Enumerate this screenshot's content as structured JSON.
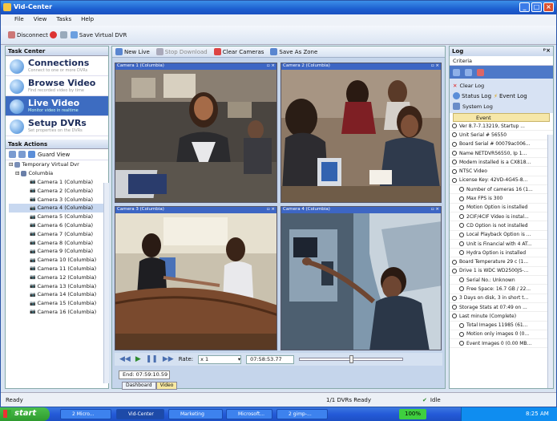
{
  "window": {
    "title": "Vid-Center"
  },
  "menu": [
    "File",
    "View",
    "Tasks",
    "Help"
  ],
  "toolbar": {
    "disconnect": "Disconnect",
    "save_vdvr": "Save Virtual DVR"
  },
  "task_center": {
    "header": "Task Center",
    "items": [
      {
        "title": "Connections",
        "sub": "Connect to one or more DVRs"
      },
      {
        "title": "Browse Video",
        "sub": "Find recorded video by time"
      },
      {
        "title": "Live Video",
        "sub": "Monitor video in realtime"
      },
      {
        "title": "Setup DVRs",
        "sub": "Set properties on the DVRs"
      }
    ]
  },
  "task_actions": {
    "header": "Task Actions",
    "guard_view": "Guard View",
    "tree_root": "Temporary Virtual Dvr",
    "tree_site": "Columbia",
    "cameras": [
      "Camera 1 (Columbia)",
      "Camera 2 (Columbia)",
      "Camera 3 (Columbia)",
      "Camera 4 (Columbia)",
      "Camera 5 (Columbia)",
      "Camera 6 (Columbia)",
      "Camera 7 (Columbia)",
      "Camera 8 (Columbia)",
      "Camera 9 (Columbia)",
      "Camera 10 (Columbia)",
      "Camera 11 (Columbia)",
      "Camera 12 (Columbia)",
      "Camera 13 (Columbia)",
      "Camera 14 (Columbia)",
      "Camera 15 (Columbia)",
      "Camera 16 (Columbia)"
    ]
  },
  "center_toolbar": {
    "new_live": "New Live",
    "stop_download": "Stop Download",
    "clear_cameras": "Clear Cameras",
    "save_as_zone": "Save As Zone"
  },
  "cameras_view": [
    {
      "label": "Camera 1 (Columbia)"
    },
    {
      "label": "Camera 2 (Columbia)"
    },
    {
      "label": "Camera 3 (Columbia)"
    },
    {
      "label": "Camera 4 (Columbia)"
    }
  ],
  "playback": {
    "rate_label": "Rate:",
    "rate_value": "x 1",
    "time": "07:58:53.77",
    "end": "End: 07:59:10.59"
  },
  "bottom_tabs": [
    "Dashboard",
    "Video"
  ],
  "log": {
    "header": "Log",
    "criteria": "Criteria",
    "clear_log": "Clear Log",
    "status_log": "Status Log",
    "event_log": "Event Log",
    "system_log": "System Log",
    "column": "Event",
    "entries": [
      {
        "text": "Ver 8.7-7.13219, Startup ...",
        "indent": false
      },
      {
        "text": "Unit Serial # 56550",
        "indent": false
      },
      {
        "text": "Board Serial # 00079ac006...",
        "indent": false
      },
      {
        "text": "Name NETDVR56550, Ip 1...",
        "indent": false
      },
      {
        "text": "Modem installed is a CX818...",
        "indent": false
      },
      {
        "text": "NTSC Video",
        "indent": false
      },
      {
        "text": "License Key: 42VD-4G45-8...",
        "indent": false
      },
      {
        "text": "Number of cameras 16 (1...",
        "indent": true
      },
      {
        "text": "Max FPS is 300",
        "indent": true
      },
      {
        "text": "Motion Option is installed",
        "indent": true
      },
      {
        "text": "2CIF/4CIF Video is instal...",
        "indent": true
      },
      {
        "text": "CD Option is not installed",
        "indent": true
      },
      {
        "text": "Local Playback Option is ...",
        "indent": true
      },
      {
        "text": "Unit is Financial with 4 AT...",
        "indent": true
      },
      {
        "text": "Hydra Option is installed",
        "indent": true
      },
      {
        "text": "Board Temperature 29 c (1...",
        "indent": false
      },
      {
        "text": "Drive 1 is WDC WD2500JS-...",
        "indent": false
      },
      {
        "text": "Serial No.: Unknown",
        "indent": true
      },
      {
        "text": "Free Space: 16.7 GB / 22...",
        "indent": true
      },
      {
        "text": "3 Days on disk, 3 in short t...",
        "indent": false
      },
      {
        "text": "Storage Stats at 07:49 on ...",
        "indent": false
      },
      {
        "text": "Last minute (Complete)",
        "indent": false
      },
      {
        "text": "Total Images 11985 (61...",
        "indent": true
      },
      {
        "text": "Motion only images 0 (0...",
        "indent": true
      },
      {
        "text": "Event Images 0 (0.00 MB...",
        "indent": true
      }
    ]
  },
  "status": {
    "left": "Ready",
    "dvrs": "1/1 DVRs Ready",
    "right": "Idle"
  },
  "taskbar": {
    "start": "start",
    "items": [
      "2 Micro...",
      "Vid-Center",
      "Marketing",
      "Microsoft...",
      "2 gimp-..."
    ],
    "zoom": "100%",
    "clock": "8:25 AM"
  },
  "colors": {
    "accent": "#3d6cc1",
    "titlebar": "#1d5fd0",
    "log_header": "#f6e7a8"
  }
}
